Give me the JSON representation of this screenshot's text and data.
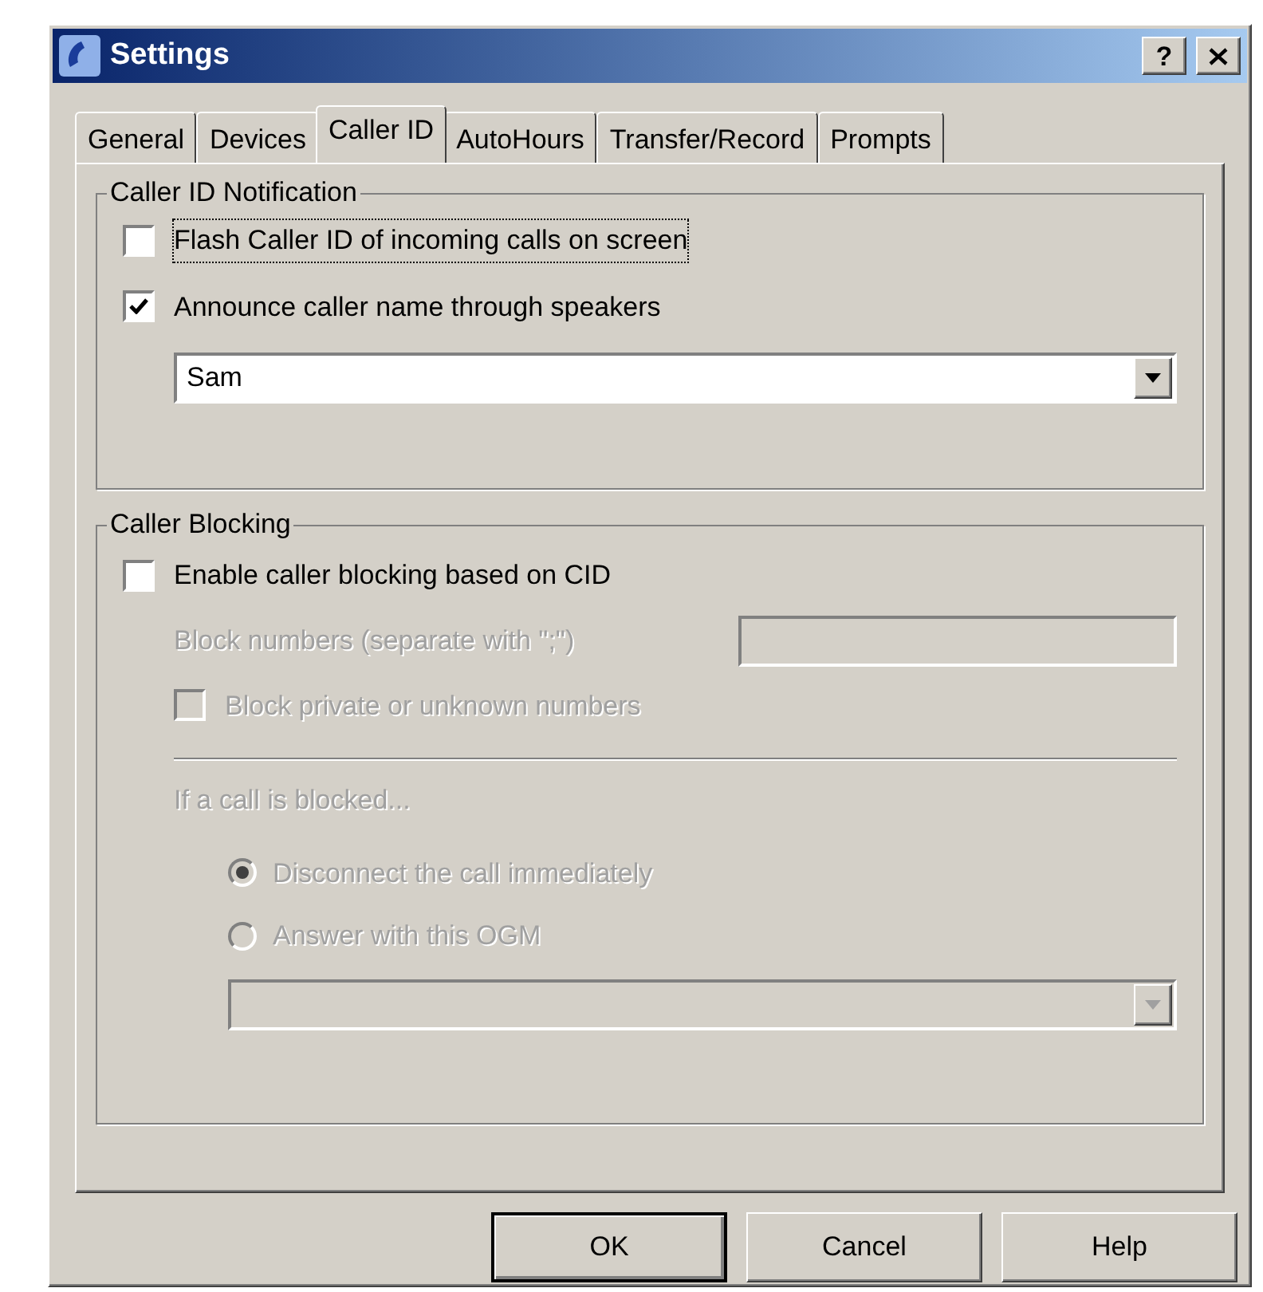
{
  "window": {
    "title": "Settings",
    "help_button": "?"
  },
  "tabs": [
    {
      "label": "General",
      "selected": false
    },
    {
      "label": "Devices",
      "selected": false
    },
    {
      "label": "Caller ID",
      "selected": true
    },
    {
      "label": "AutoHours",
      "selected": false
    },
    {
      "label": "Transfer/Record",
      "selected": false
    },
    {
      "label": "Prompts",
      "selected": false
    }
  ],
  "notification": {
    "title": "Caller ID Notification",
    "checkboxes": [
      {
        "label": "Flash Caller ID of incoming calls on screen",
        "checked": false,
        "focused": true
      },
      {
        "label": "Announce caller name through speakers",
        "checked": true,
        "focused": false
      }
    ],
    "voice_dropdown": {
      "value": "Sam",
      "disabled": false
    }
  },
  "blocking": {
    "title": "Caller Blocking",
    "enable_checkbox": {
      "label": "Enable caller blocking based on CID",
      "checked": false,
      "disabled": false
    },
    "block_numbers": {
      "label": "Block numbers (separate with \";\")",
      "disabled": true
    },
    "private_checkbox": {
      "label": "Block private or unknown numbers",
      "checked": false,
      "disabled": true
    },
    "if_blocked_label": {
      "text": "If a call is blocked...",
      "disabled": true
    },
    "radios": [
      {
        "label": "Disconnect the call immediately",
        "selected": true,
        "disabled": true
      },
      {
        "label": "Answer with this OGM",
        "selected": false,
        "disabled": true
      }
    ],
    "ogm_dropdown": {
      "disabled": true
    }
  },
  "buttons": [
    {
      "label": "OK",
      "default": true
    },
    {
      "label": "Cancel",
      "default": false
    },
    {
      "label": "Help",
      "default": false
    }
  ]
}
